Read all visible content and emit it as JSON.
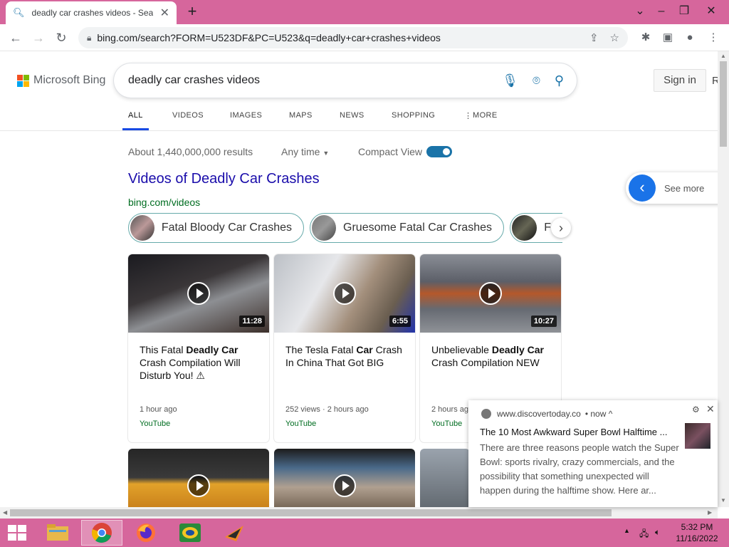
{
  "browser": {
    "tab_title": "deadly car crashes videos - Search",
    "url": "bing.com/search?FORM=U523DF&PC=U523&q=deadly+car+crashes+videos"
  },
  "header": {
    "logo_text": "Microsoft Bing",
    "query": "deadly car crashes videos",
    "sign_in": "Sign in",
    "cut_text": "R"
  },
  "scopes": [
    "ALL",
    "VIDEOS",
    "IMAGES",
    "MAPS",
    "NEWS",
    "SHOPPING",
    "MORE"
  ],
  "results_info": {
    "count": "About 1,440,000,000 results",
    "any_time": "Any time",
    "compact_view": "Compact View",
    "compact_on": true
  },
  "videos": {
    "heading": "Videos of Deadly Car Crashes",
    "source": "bing.com/videos",
    "chips": [
      "Fatal Bloody Car Crashes",
      "Gruesome Fatal Car Crashes",
      "F"
    ],
    "cards": [
      {
        "pre": "This Fatal ",
        "bold": "Deadly Car",
        "post": " Crash Compilation Will Disturb You! ⚠",
        "duration": "11:28",
        "meta": "1 hour ago",
        "source": "YouTube"
      },
      {
        "pre": "The Tesla Fatal ",
        "bold": "Car",
        "post": " Crash In China That Got BIG",
        "duration": "6:55",
        "meta": "252 views · 2 hours ago",
        "source": "YouTube"
      },
      {
        "pre": "Unbelievable ",
        "bold": "Deadly Car",
        "post": " Crash Compilation NEW",
        "duration": "10:27",
        "meta": "2 hours ag",
        "source": "YouTube"
      }
    ],
    "see_more": "See more"
  },
  "notification": {
    "source": "www.discovertoday.co",
    "time": "• now ^",
    "title": "The 10 Most Awkward Super Bowl Halftime ...",
    "body": "There are three reasons people watch the Super Bowl: sports rivalry, crazy commercials, and the possibility that something unexpected will happen during the halftime show. Here ar..."
  },
  "taskbar": {
    "time": "5:32 PM",
    "date": "11/16/2022"
  },
  "colors": {
    "titlebar": "#d6669c",
    "bing_blue": "#174ae4",
    "link": "#1a0dab",
    "green": "#006d21"
  }
}
